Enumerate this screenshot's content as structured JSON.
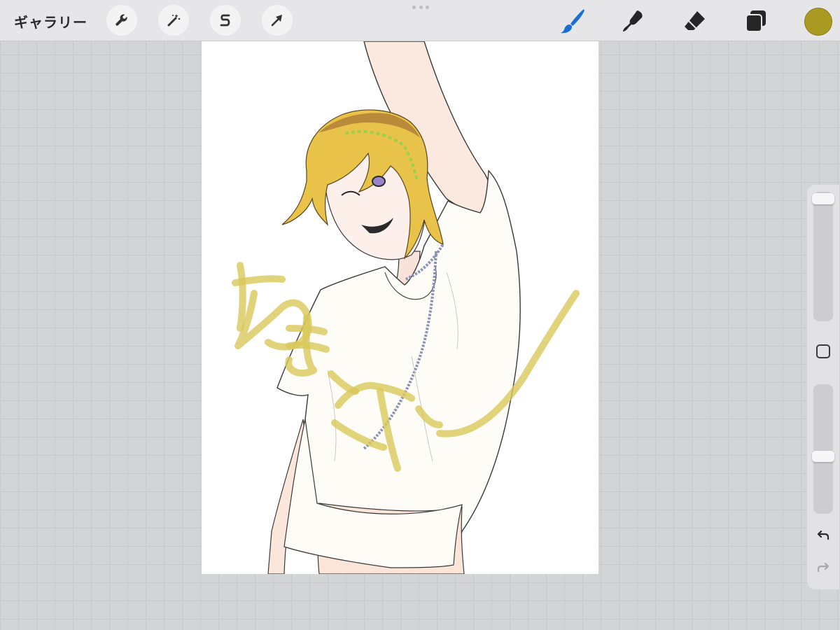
{
  "topbar": {
    "gallery_label": "ギャラリー",
    "left_tools": [
      {
        "name": "actions",
        "icon": "wrench-icon"
      },
      {
        "name": "adjustments",
        "icon": "magic-wand-icon"
      },
      {
        "name": "selection",
        "icon": "selection-s-icon"
      },
      {
        "name": "transform",
        "icon": "arrow-cursor-icon"
      }
    ],
    "right_tools": [
      {
        "name": "brush",
        "icon": "brush-icon",
        "active": true
      },
      {
        "name": "smudge",
        "icon": "smudge-icon"
      },
      {
        "name": "eraser",
        "icon": "eraser-icon"
      },
      {
        "name": "layers",
        "icon": "layers-icon"
      }
    ],
    "current_color": "#ab9a22",
    "active_tool_color": "#1a6fd4"
  },
  "sidebar": {
    "brush_size_level": 0.0,
    "opacity_level": 0.55,
    "icons": [
      "modify-square-icon",
      "undo-icon",
      "redo-icon"
    ]
  },
  "canvas": {
    "stroke_color": "#d9c85a"
  }
}
